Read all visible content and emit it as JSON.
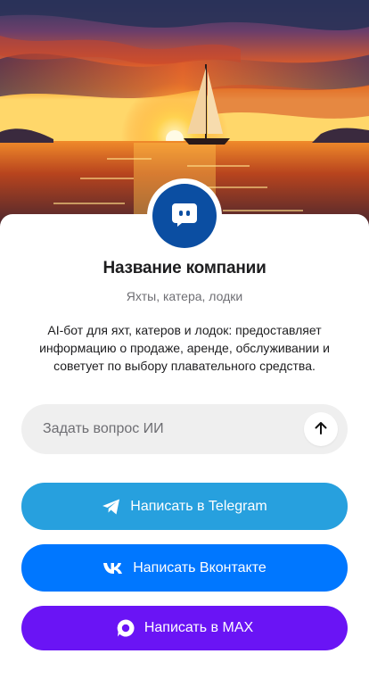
{
  "hero": {
    "image": "sunset-sailboat-photo"
  },
  "avatar": {
    "icon": "chat-bot-icon",
    "color": "#0b4ea2"
  },
  "company": {
    "name": "Название компании",
    "tagline": "Яхты, катера, лодки",
    "description": "AI-бот для яхт, катеров и лодок: предоставляет информацию о продаже, аренде, обслуживании и советует по выбору плавательного средства."
  },
  "ask": {
    "placeholder": "Задать вопрос ИИ",
    "send_icon": "arrow-up-icon"
  },
  "buttons": {
    "telegram": {
      "label": "Написать в Telegram",
      "icon": "telegram-icon",
      "color": "#27a0de"
    },
    "vk": {
      "label": "Написать Вконтакте",
      "icon": "vk-icon",
      "color": "#0077ff"
    },
    "max": {
      "label": "Написать в MAX",
      "icon": "max-icon",
      "color": "#6a14f5"
    }
  }
}
